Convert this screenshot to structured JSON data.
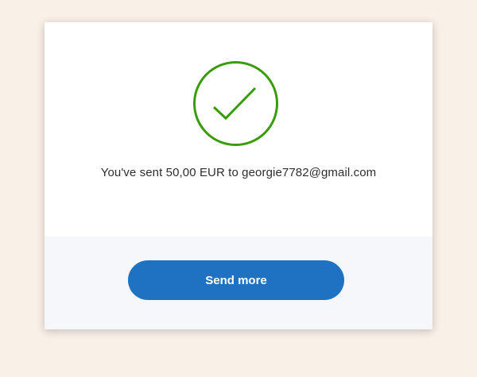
{
  "confirmation": {
    "icon": "checkmark-circle-icon",
    "icon_color": "#3a9b0d",
    "message": "You've sent 50,00 EUR to georgie7782@gmail.com"
  },
  "actions": {
    "send_more_label": "Send more",
    "button_color": "#1f72c1"
  }
}
